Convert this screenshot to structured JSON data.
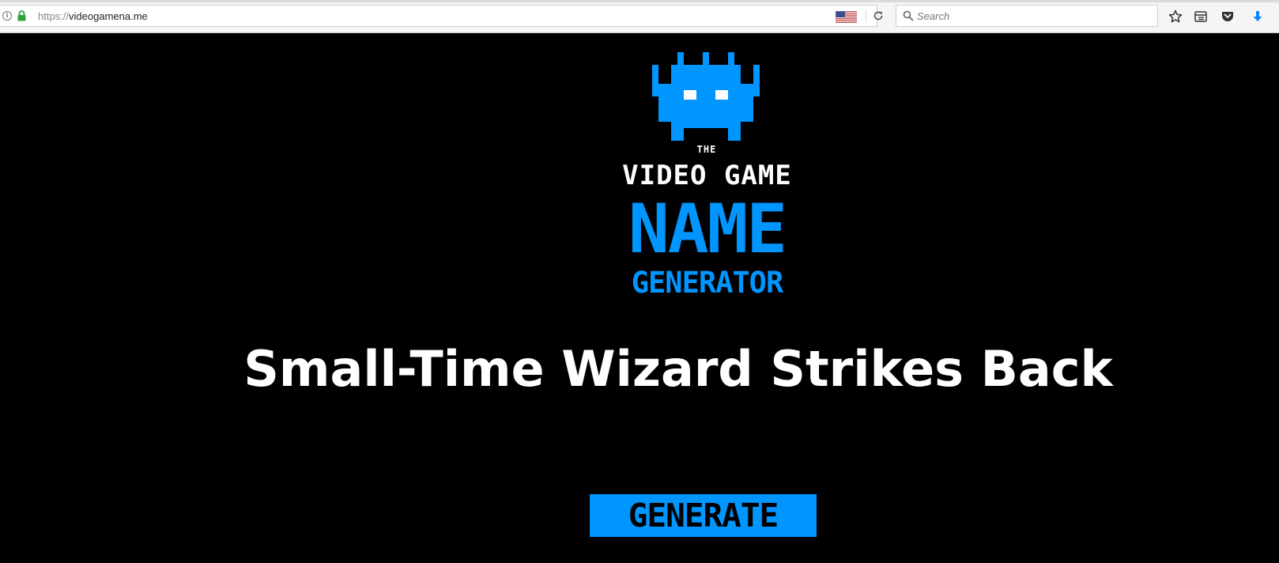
{
  "browser": {
    "url_scheme": "https://",
    "url_host": "videogamena.me",
    "search_placeholder": "Search",
    "icons": [
      "info-icon",
      "lock-icon",
      "us-flag-icon",
      "reload-icon",
      "search-icon",
      "bookmark-star-icon",
      "reading-list-icon",
      "pocket-icon",
      "download-icon"
    ]
  },
  "logo": {
    "the": "THE",
    "line1": "VIDEO GAME",
    "line2": "NAME",
    "line3": "GENERATOR",
    "icon": "space-invader-icon"
  },
  "generated_name": "Small-Time Wizard Strikes Back",
  "generate_button_label": "GENERATE",
  "colors": {
    "accent": "#0095ff",
    "background": "#000000",
    "text": "#ffffff"
  }
}
